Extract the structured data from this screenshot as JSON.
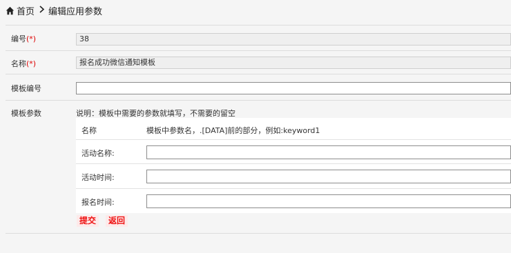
{
  "breadcrumb": {
    "home_label": "首页",
    "current_label": "编辑应用参数"
  },
  "form": {
    "id_label": "编号",
    "id_required": "(*)",
    "id_value": "38",
    "name_label": "名称",
    "name_required": "(*)",
    "name_value": "报名成功微信通知模板",
    "template_no_label": "模板编号",
    "template_no_value": "",
    "template_params_label": "模板参数",
    "template_params_hint": "说明：模板中需要的参数就填写，不需要的留空",
    "params_table": {
      "header_name": "名称",
      "header_desc": "模板中参数名，.[DATA]前的部分，例如:keyword1",
      "rows": [
        {
          "label": "活动名称:",
          "value": ""
        },
        {
          "label": "活动时间:",
          "value": ""
        },
        {
          "label": "报名时间:",
          "value": ""
        }
      ]
    }
  },
  "actions": {
    "submit_label": "提交",
    "back_label": "返回"
  },
  "colors": {
    "required": "#dd0000",
    "button_text": "#ee1111",
    "button_bg": "#fdeaea"
  },
  "icons": {
    "home": "home-icon",
    "separator": "chevron-right-icon"
  }
}
